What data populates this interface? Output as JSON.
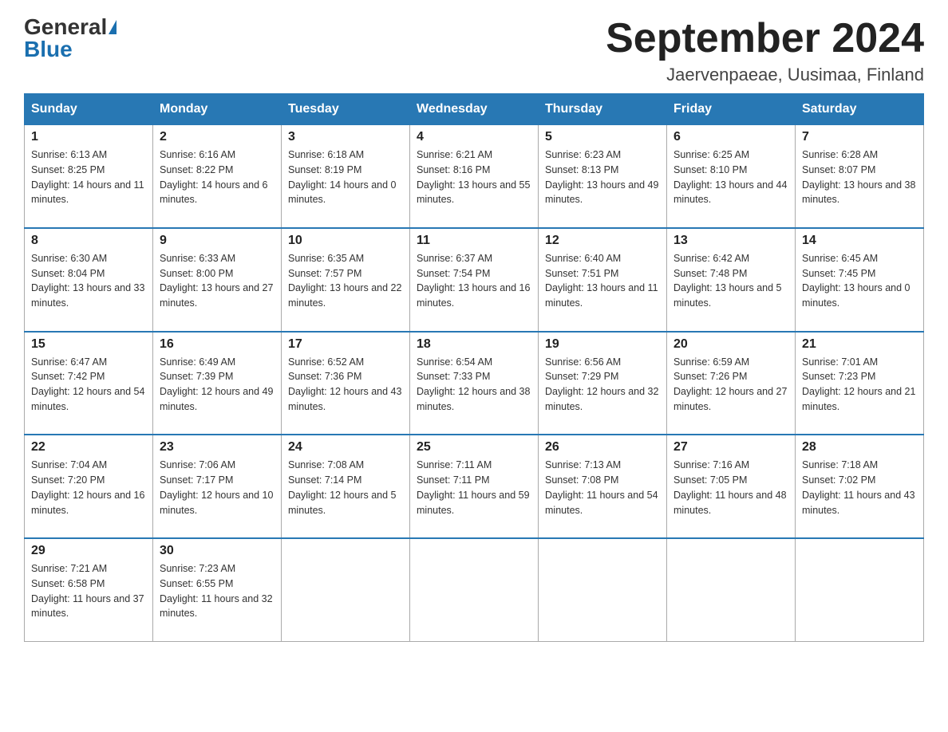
{
  "header": {
    "logo_general": "General",
    "logo_blue": "Blue",
    "month_title": "September 2024",
    "location": "Jaervenpaeae, Uusimaa, Finland"
  },
  "weekdays": [
    "Sunday",
    "Monday",
    "Tuesday",
    "Wednesday",
    "Thursday",
    "Friday",
    "Saturday"
  ],
  "weeks": [
    [
      {
        "day": "1",
        "sunrise": "6:13 AM",
        "sunset": "8:25 PM",
        "daylight": "14 hours and 11 minutes."
      },
      {
        "day": "2",
        "sunrise": "6:16 AM",
        "sunset": "8:22 PM",
        "daylight": "14 hours and 6 minutes."
      },
      {
        "day": "3",
        "sunrise": "6:18 AM",
        "sunset": "8:19 PM",
        "daylight": "14 hours and 0 minutes."
      },
      {
        "day": "4",
        "sunrise": "6:21 AM",
        "sunset": "8:16 PM",
        "daylight": "13 hours and 55 minutes."
      },
      {
        "day": "5",
        "sunrise": "6:23 AM",
        "sunset": "8:13 PM",
        "daylight": "13 hours and 49 minutes."
      },
      {
        "day": "6",
        "sunrise": "6:25 AM",
        "sunset": "8:10 PM",
        "daylight": "13 hours and 44 minutes."
      },
      {
        "day": "7",
        "sunrise": "6:28 AM",
        "sunset": "8:07 PM",
        "daylight": "13 hours and 38 minutes."
      }
    ],
    [
      {
        "day": "8",
        "sunrise": "6:30 AM",
        "sunset": "8:04 PM",
        "daylight": "13 hours and 33 minutes."
      },
      {
        "day": "9",
        "sunrise": "6:33 AM",
        "sunset": "8:00 PM",
        "daylight": "13 hours and 27 minutes."
      },
      {
        "day": "10",
        "sunrise": "6:35 AM",
        "sunset": "7:57 PM",
        "daylight": "13 hours and 22 minutes."
      },
      {
        "day": "11",
        "sunrise": "6:37 AM",
        "sunset": "7:54 PM",
        "daylight": "13 hours and 16 minutes."
      },
      {
        "day": "12",
        "sunrise": "6:40 AM",
        "sunset": "7:51 PM",
        "daylight": "13 hours and 11 minutes."
      },
      {
        "day": "13",
        "sunrise": "6:42 AM",
        "sunset": "7:48 PM",
        "daylight": "13 hours and 5 minutes."
      },
      {
        "day": "14",
        "sunrise": "6:45 AM",
        "sunset": "7:45 PM",
        "daylight": "13 hours and 0 minutes."
      }
    ],
    [
      {
        "day": "15",
        "sunrise": "6:47 AM",
        "sunset": "7:42 PM",
        "daylight": "12 hours and 54 minutes."
      },
      {
        "day": "16",
        "sunrise": "6:49 AM",
        "sunset": "7:39 PM",
        "daylight": "12 hours and 49 minutes."
      },
      {
        "day": "17",
        "sunrise": "6:52 AM",
        "sunset": "7:36 PM",
        "daylight": "12 hours and 43 minutes."
      },
      {
        "day": "18",
        "sunrise": "6:54 AM",
        "sunset": "7:33 PM",
        "daylight": "12 hours and 38 minutes."
      },
      {
        "day": "19",
        "sunrise": "6:56 AM",
        "sunset": "7:29 PM",
        "daylight": "12 hours and 32 minutes."
      },
      {
        "day": "20",
        "sunrise": "6:59 AM",
        "sunset": "7:26 PM",
        "daylight": "12 hours and 27 minutes."
      },
      {
        "day": "21",
        "sunrise": "7:01 AM",
        "sunset": "7:23 PM",
        "daylight": "12 hours and 21 minutes."
      }
    ],
    [
      {
        "day": "22",
        "sunrise": "7:04 AM",
        "sunset": "7:20 PM",
        "daylight": "12 hours and 16 minutes."
      },
      {
        "day": "23",
        "sunrise": "7:06 AM",
        "sunset": "7:17 PM",
        "daylight": "12 hours and 10 minutes."
      },
      {
        "day": "24",
        "sunrise": "7:08 AM",
        "sunset": "7:14 PM",
        "daylight": "12 hours and 5 minutes."
      },
      {
        "day": "25",
        "sunrise": "7:11 AM",
        "sunset": "7:11 PM",
        "daylight": "11 hours and 59 minutes."
      },
      {
        "day": "26",
        "sunrise": "7:13 AM",
        "sunset": "7:08 PM",
        "daylight": "11 hours and 54 minutes."
      },
      {
        "day": "27",
        "sunrise": "7:16 AM",
        "sunset": "7:05 PM",
        "daylight": "11 hours and 48 minutes."
      },
      {
        "day": "28",
        "sunrise": "7:18 AM",
        "sunset": "7:02 PM",
        "daylight": "11 hours and 43 minutes."
      }
    ],
    [
      {
        "day": "29",
        "sunrise": "7:21 AM",
        "sunset": "6:58 PM",
        "daylight": "11 hours and 37 minutes."
      },
      {
        "day": "30",
        "sunrise": "7:23 AM",
        "sunset": "6:55 PM",
        "daylight": "11 hours and 32 minutes."
      },
      null,
      null,
      null,
      null,
      null
    ]
  ],
  "labels": {
    "sunrise": "Sunrise:",
    "sunset": "Sunset:",
    "daylight": "Daylight:"
  }
}
